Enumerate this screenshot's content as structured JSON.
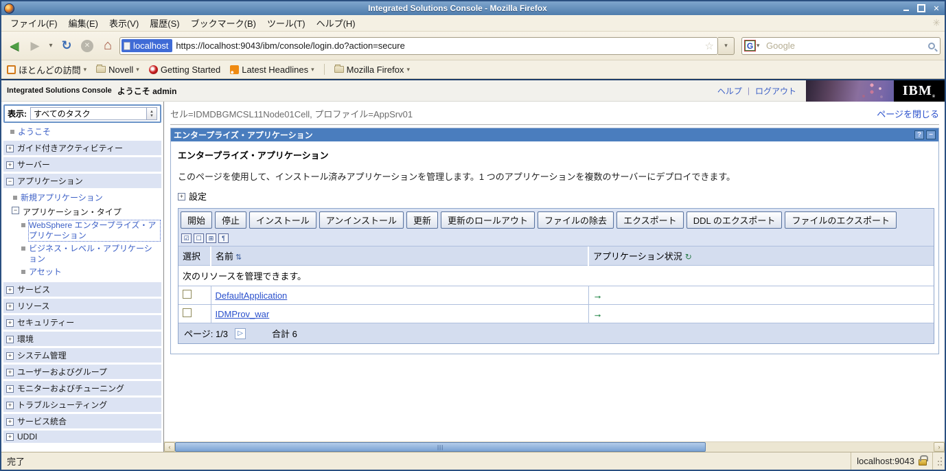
{
  "window": {
    "title": "Integrated Solutions Console - Mozilla Firefox"
  },
  "menu": {
    "items": [
      "ファイル(F)",
      "編集(E)",
      "表示(V)",
      "履歴(S)",
      "ブックマーク(B)",
      "ツール(T)",
      "ヘルプ(H)"
    ]
  },
  "navbar": {
    "identity_label": "localhost",
    "url": "https://localhost:9043/ibm/console/login.do?action=secure",
    "search_placeholder": "Google",
    "search_engine_letter": "G"
  },
  "bookmarks": {
    "items": [
      "ほとんどの訪問",
      "Novell",
      "Getting Started",
      "Latest Headlines",
      "Mozilla Firefox"
    ]
  },
  "console_header": {
    "brand": "Integrated Solutions Console",
    "welcome": "ようこそ admin",
    "help_link": "ヘルプ",
    "separator": "|",
    "logout_link": "ログアウト",
    "logo_text": "IBM",
    "logo_mark": "®"
  },
  "sidebar": {
    "view_label": "表示:",
    "view_value": "すべてのタスク",
    "items": {
      "welcome": "ようこそ",
      "guided_activities": "ガイド付きアクティビティー",
      "servers": "サーバー",
      "applications": "アプリケーション",
      "new_application": "新規アプリケーション",
      "application_types": "アプリケーション・タイプ",
      "websphere_enterprise_applications": "WebSphere エンタープライズ・アプリケーション",
      "business_level_applications": "ビジネス・レベル・アプリケーション",
      "assets": "アセット",
      "services": "サービス",
      "resources": "リソース",
      "security": "セキュリティー",
      "environment": "環境",
      "system_administration": "システム管理",
      "users_and_groups": "ユーザーおよびグループ",
      "monitoring_and_tuning": "モニターおよびチューニング",
      "troubleshooting": "トラブルシューティング",
      "service_integration": "サービス統合",
      "uddi": "UDDI"
    }
  },
  "content": {
    "breadcrumb": "セル=IDMDBGMCSL11Node01Cell, プロファイル=AppSrv01",
    "close_page_link": "ページを閉じる",
    "panel_title": "エンタープライズ・アプリケーション",
    "panel_help_button": "?",
    "panel_minimize_button": "−",
    "heading": "エンタープライズ・アプリケーション",
    "description": "このページを使用して、インストール済みアプリケーションを管理します。1 つのアプリケーションを複数のサーバーにデプロイできます。",
    "preferences_label": "設定",
    "buttons": [
      "開始",
      "停止",
      "インストール",
      "アンインストール",
      "更新",
      "更新のロールアウト",
      "ファイルの除去",
      "エクスポート",
      "DDL のエクスポート",
      "ファイルのエクスポート"
    ],
    "table": {
      "columns": [
        "選択",
        "名前",
        "アプリケーション状況"
      ],
      "caption": "次のリソースを管理できます。",
      "rows": [
        {
          "name": "DefaultApplication",
          "status": "started"
        },
        {
          "name": "IDMProv_war",
          "status": "started"
        }
      ],
      "pagination": {
        "page": "ページ: 1/3",
        "total": "合計 6"
      }
    }
  },
  "statusbar": {
    "status": "完了",
    "host": "localhost:9043"
  },
  "colors": {
    "panel_title_blue": "#4a7dbe",
    "link_blue": "#3b5fc6",
    "section_lavender": "#dce3f3",
    "status_green": "#1f8f46",
    "titlebar_blue": "#4e7cac"
  }
}
